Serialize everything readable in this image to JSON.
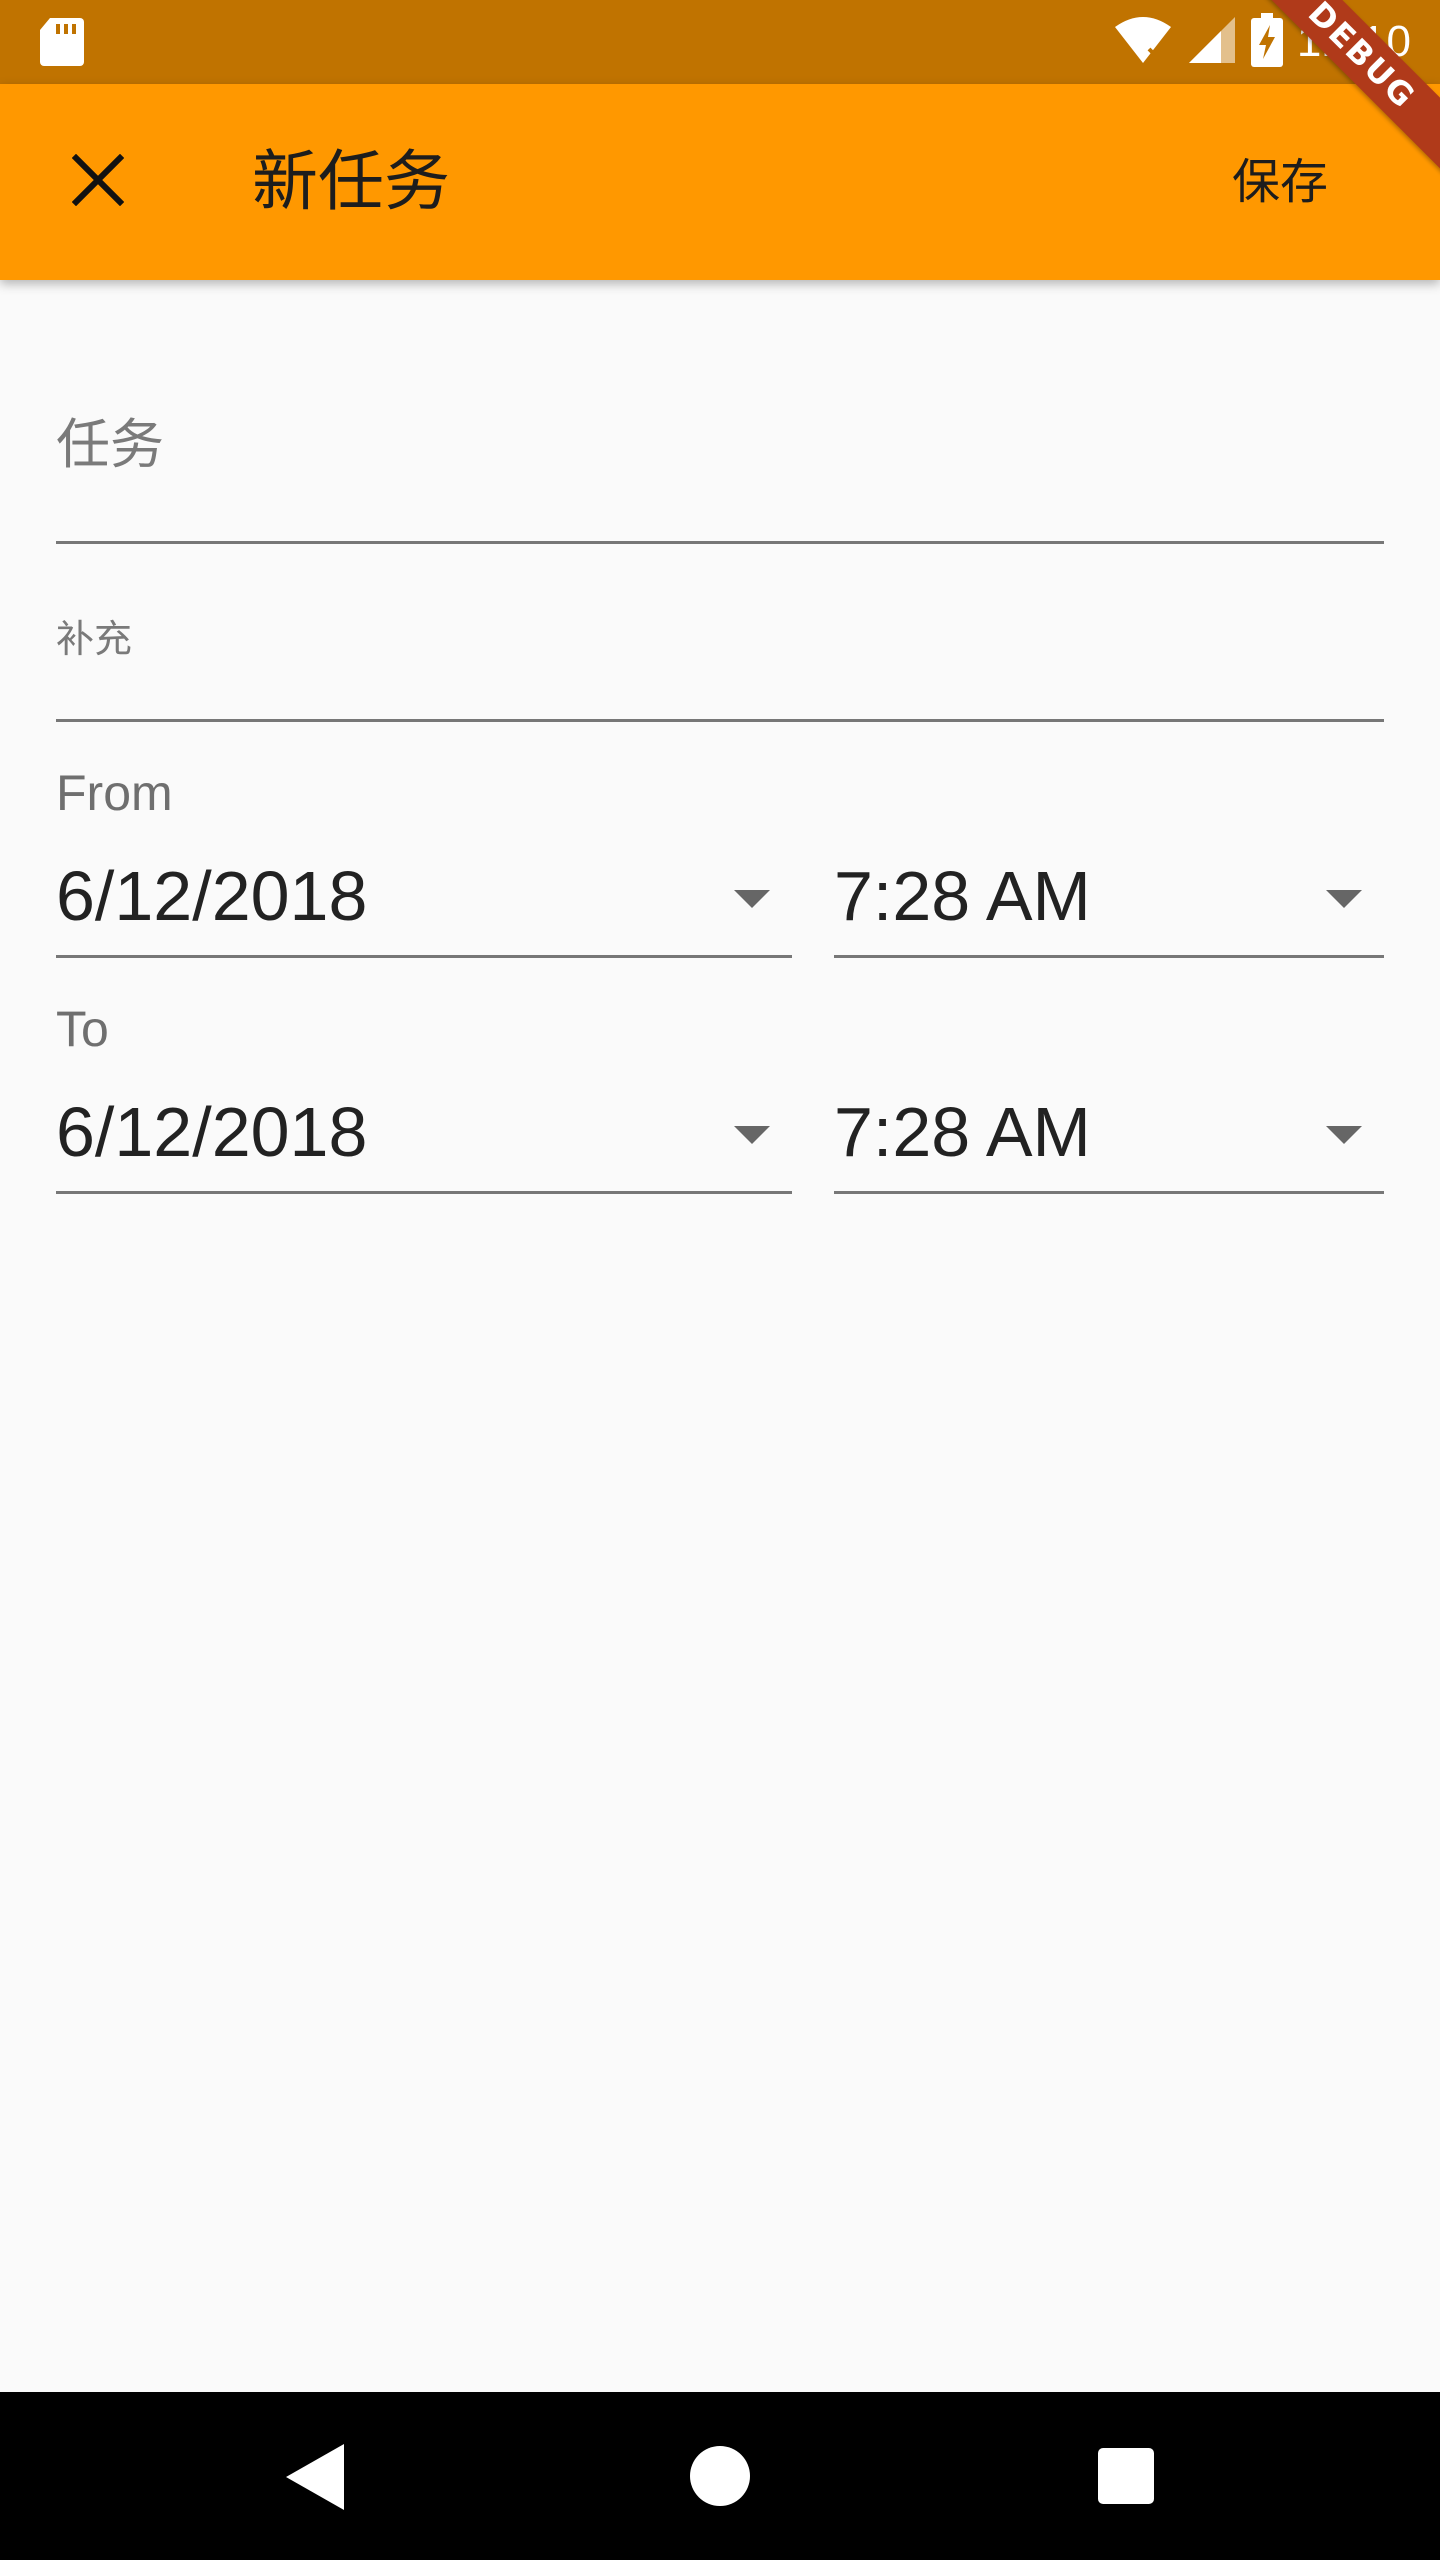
{
  "status_bar": {
    "time": "12:10",
    "icons": [
      "sd-card-icon",
      "wifi-icon",
      "signal-icon",
      "battery-charging-icon"
    ]
  },
  "app_bar": {
    "close_icon": "close-icon",
    "title": "新任务",
    "save_label": "保存"
  },
  "debug_banner": "DEBUG",
  "form": {
    "task": {
      "placeholder": "任务",
      "value": ""
    },
    "note": {
      "placeholder": "补充",
      "value": ""
    },
    "from": {
      "label": "From",
      "date": "6/12/2018",
      "time": "7:28 AM"
    },
    "to": {
      "label": "To",
      "date": "6/12/2018",
      "time": "7:28 AM"
    }
  },
  "nav_bar": {
    "icons": [
      "back-icon",
      "home-icon",
      "recents-icon"
    ]
  },
  "colors": {
    "status_bar": "#c07300",
    "app_bar": "#ff9800",
    "background": "#fafafa",
    "debug_banner": "#b03a1a",
    "nav_bar": "#000000"
  }
}
